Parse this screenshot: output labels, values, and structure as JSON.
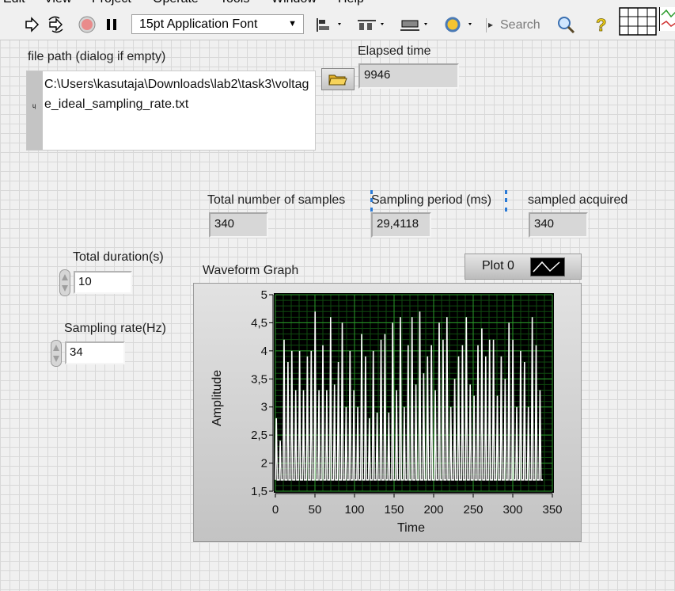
{
  "menu": [
    "Edit",
    "View",
    "Project",
    "Operate",
    "Tools",
    "Window",
    "Help"
  ],
  "toolbar": {
    "font": "15pt Application Font",
    "search_placeholder": "Search",
    "icons": [
      "run-arrow-icon",
      "run-continuously-icon",
      "abort-icon",
      "pause-icon",
      "align-icon",
      "distribute-icon",
      "resize-icon",
      "reorder-icon",
      "search-icon",
      "help-icon"
    ]
  },
  "file_path": {
    "label": "file path (dialog if empty)",
    "value": "C:\\Users\\kasutaja\\Downloads\\lab2\\task3\\voltage_ideal_sampling_rate.txt"
  },
  "elapsed": {
    "label": "Elapsed time",
    "value": "9946"
  },
  "total_samples": {
    "label": "Total number of samples",
    "value": "340"
  },
  "sampling_period": {
    "label": "Sampling period (ms)",
    "value": "29,4118"
  },
  "sampled_acquired": {
    "label": "sampled acquired",
    "value": "340"
  },
  "total_duration": {
    "label": "Total duration(s)",
    "value": "10"
  },
  "sampling_rate": {
    "label": "Sampling rate(Hz)",
    "value": "34"
  },
  "graph": {
    "label": "Waveform Graph",
    "legend": "Plot 0"
  },
  "chart_data": {
    "type": "line",
    "title": "Waveform Graph",
    "xlabel": "Time",
    "ylabel": "Amplitude",
    "xlim": [
      0,
      350
    ],
    "ylim": [
      1.5,
      5
    ],
    "x_ticks": [
      "0",
      "50",
      "100",
      "150",
      "200",
      "250",
      "300",
      "350"
    ],
    "y_ticks": [
      "1,5",
      "2",
      "2,5",
      "3",
      "3,5",
      "4",
      "4,5",
      "5"
    ],
    "grid": true,
    "legend_position": "top-right",
    "series": [
      {
        "name": "Plot 0",
        "color": "#ffffff",
        "baseline": 1.7,
        "peak_period": 4.9,
        "peaks": [
          2.8,
          2.4,
          4.2,
          3.8,
          4.0,
          3.3,
          4.0,
          3.3,
          3.9,
          4.0,
          4.7,
          3.3,
          4.1,
          3.3,
          4.6,
          3.4,
          3.8,
          4.5,
          3.0,
          4.0,
          3.3,
          3.0,
          4.3,
          3.9,
          2.8,
          4.0,
          2.9,
          4.2,
          4.3,
          2.9,
          4.5,
          3.3,
          4.6,
          3.0,
          4.1,
          4.6,
          3.4,
          4.7,
          3.6,
          3.9,
          4.1,
          3.3,
          4.5,
          4.2,
          4.6,
          3.0,
          3.5,
          3.9,
          4.1,
          4.6,
          3.4,
          3.2,
          4.1,
          4.4,
          3.9,
          4.2,
          4.2,
          3.2,
          3.9,
          3.5,
          4.5,
          4.2,
          3.0,
          4.0,
          3.8,
          3.0,
          4.6,
          4.1,
          3.3
        ]
      }
    ]
  }
}
